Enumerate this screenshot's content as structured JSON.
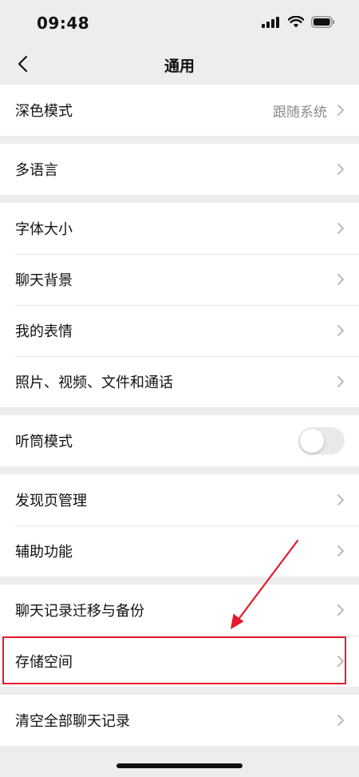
{
  "status_bar": {
    "time": "09:48"
  },
  "nav": {
    "title": "通用"
  },
  "groups": [
    {
      "rows": [
        {
          "label": "深色模式",
          "value": "跟随系统"
        }
      ]
    },
    {
      "rows": [
        {
          "label": "多语言"
        }
      ]
    },
    {
      "rows": [
        {
          "label": "字体大小"
        },
        {
          "label": "聊天背景"
        },
        {
          "label": "我的表情"
        },
        {
          "label": "照片、视频、文件和通话"
        }
      ]
    },
    {
      "rows": [
        {
          "label": "听筒模式",
          "toggle": false
        }
      ]
    },
    {
      "rows": [
        {
          "label": "发现页管理"
        },
        {
          "label": "辅助功能"
        }
      ]
    },
    {
      "rows": [
        {
          "label": "聊天记录迁移与备份"
        },
        {
          "label": "存储空间"
        }
      ]
    },
    {
      "rows": [
        {
          "label": "清空全部聊天记录"
        }
      ]
    }
  ],
  "annotation": {
    "color": "#e8192c",
    "highlighted_row": "存储空间"
  },
  "icons": {
    "back": "chevron-left-icon",
    "row": "chevron-right-icon"
  }
}
